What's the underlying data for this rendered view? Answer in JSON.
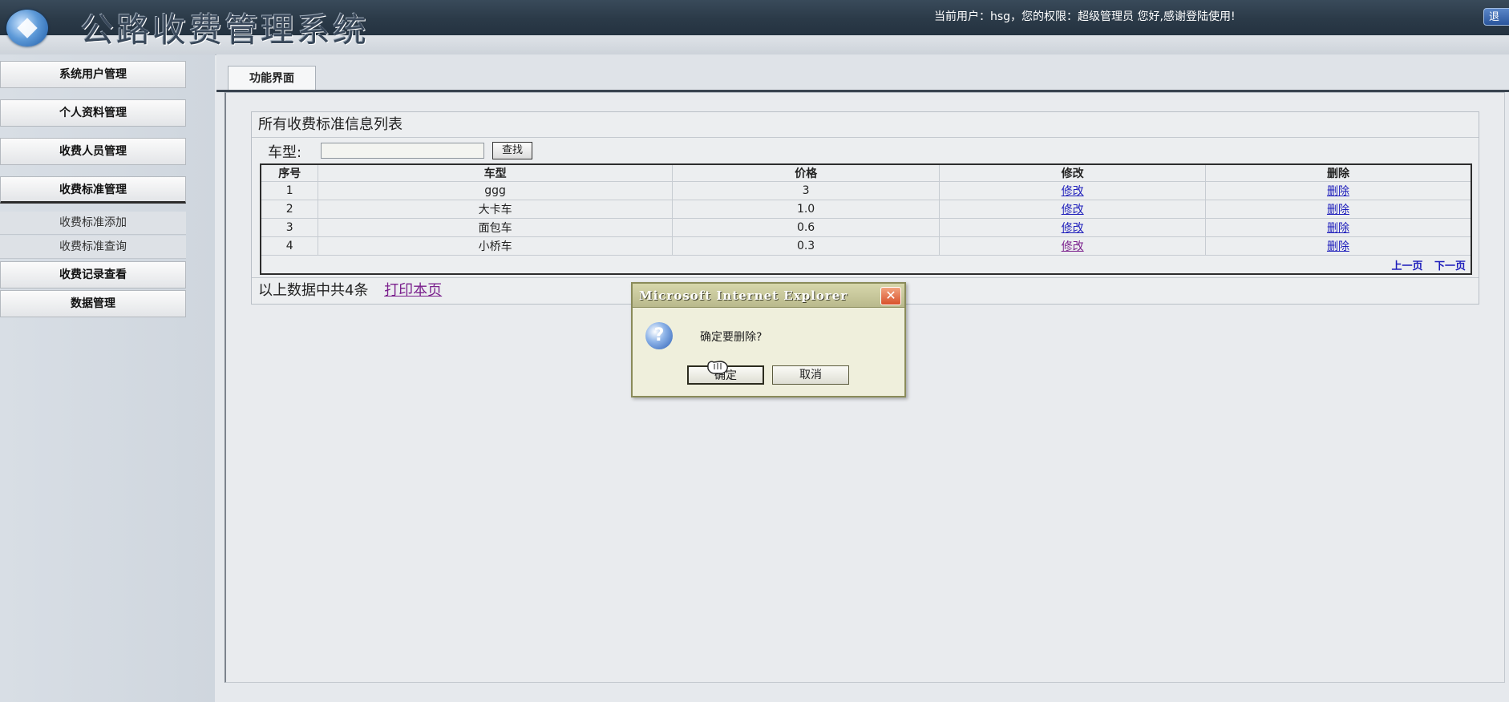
{
  "header": {
    "app_title": "公路收费管理系统",
    "user_info": "当前用户：hsg，您的权限：超级管理员 您好,感谢登陆使用!",
    "logout_label": "退"
  },
  "sidebar": {
    "items": [
      {
        "label": "系统用户管理"
      },
      {
        "label": "个人资料管理"
      },
      {
        "label": "收费人员管理"
      },
      {
        "label": "收费标准管理"
      },
      {
        "label": "收费记录查看"
      },
      {
        "label": "数据管理"
      }
    ],
    "subitems": [
      {
        "label": "收费标准添加"
      },
      {
        "label": "收费标准查询"
      }
    ]
  },
  "tab": {
    "label": "功能界面"
  },
  "panel": {
    "title": "所有收费标准信息列表",
    "search_label": "车型:",
    "search_value": "",
    "search_button": "查找",
    "columns": [
      "序号",
      "车型",
      "价格",
      "修改",
      "删除"
    ],
    "rows": [
      {
        "no": "1",
        "type": "ggg",
        "price": "3",
        "edit": "修改",
        "del": "删除"
      },
      {
        "no": "2",
        "type": "大卡车",
        "price": "1.0",
        "edit": "修改",
        "del": "删除"
      },
      {
        "no": "3",
        "type": "面包车",
        "price": "0.6",
        "edit": "修改",
        "del": "删除"
      },
      {
        "no": "4",
        "type": "小桥车",
        "price": "0.3",
        "edit": "修改",
        "del": "删除"
      }
    ],
    "pager_prev": "上一页",
    "pager_next": "下一页",
    "summary": "以上数据中共4条",
    "print_link": "打印本页"
  },
  "dialog": {
    "title": "Microsoft Internet Explorer",
    "icon": "question-icon",
    "message": "确定要删除?",
    "ok_label": "确定",
    "cancel_label": "取消"
  }
}
